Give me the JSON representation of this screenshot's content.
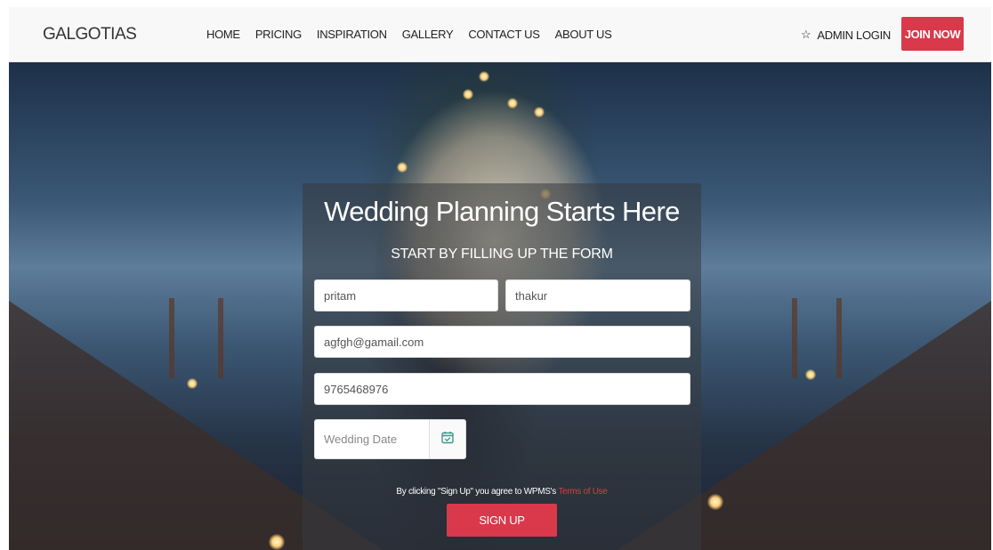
{
  "navbar": {
    "brand": "GALGOTIAS",
    "links": [
      "HOME",
      "PRICING",
      "INSPIRATION",
      "GALLERY",
      "CONTACT US",
      "ABOUT US"
    ],
    "admin_login": "ADMIN LOGIN",
    "admin_icon": "star-icon",
    "join_now": "JOIN NOW"
  },
  "hero": {
    "title": "Wedding Planning Starts Here",
    "subtitle": "START BY FILLING UP THE FORM"
  },
  "form": {
    "first_name": "pritam",
    "last_name": "thakur",
    "email": "agfgh@gamail.com",
    "phone": "9765468976",
    "date_placeholder": "Wedding Date",
    "date_icon": "calendar-check-icon",
    "terms_prefix": "By clicking \"Sign Up\" you agree to WPMS's",
    "terms_link": "Terms of Use",
    "signup": "SIGN UP"
  },
  "colors": {
    "accent": "#d9394a",
    "terms_link": "#e23a3a",
    "calendar_icon": "#3a9a8a"
  }
}
